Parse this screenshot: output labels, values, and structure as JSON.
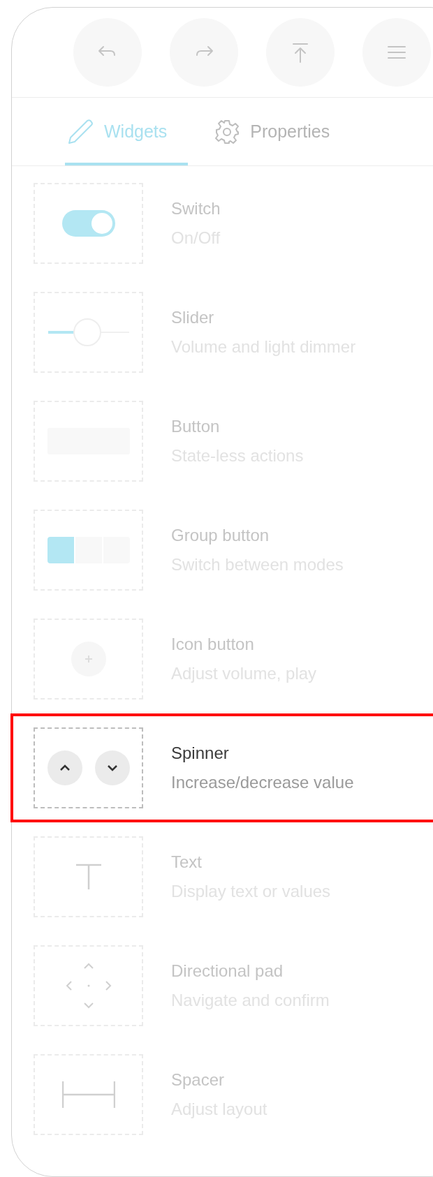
{
  "toolbar": {
    "buttons": [
      {
        "kind": "undo"
      },
      {
        "kind": "redo"
      },
      {
        "kind": "upload"
      },
      {
        "kind": "menu"
      }
    ]
  },
  "tabs": [
    {
      "kind": "pencil",
      "label": "Widgets",
      "selected": true
    },
    {
      "kind": "gear",
      "label": "Properties",
      "selected": false
    }
  ],
  "widgets": [
    {
      "kind": "switch",
      "title": "Switch",
      "description": "On/Off",
      "selected": false
    },
    {
      "kind": "slider",
      "title": "Slider",
      "description": "Volume and light dimmer",
      "selected": false
    },
    {
      "kind": "button",
      "title": "Button",
      "description": "State-less actions",
      "selected": false
    },
    {
      "kind": "group_button",
      "title": "Group button",
      "description": "Switch between modes",
      "selected": false
    },
    {
      "kind": "icon_button",
      "title": "Icon button",
      "description": "Adjust volume, play",
      "selected": false
    },
    {
      "kind": "spinner",
      "title": "Spinner",
      "description": "Increase/decrease value",
      "selected": true
    },
    {
      "kind": "text",
      "title": "Text",
      "description": "Display text or values",
      "selected": false
    },
    {
      "kind": "dpad",
      "title": "Directional pad",
      "description": "Navigate and confirm",
      "selected": false
    },
    {
      "kind": "spacer",
      "title": "Spacer",
      "description": "Adjust layout",
      "selected": false
    }
  ]
}
